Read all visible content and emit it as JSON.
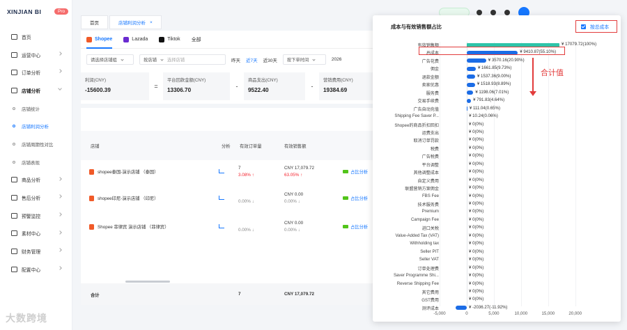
{
  "app": {
    "brand": "XINJIAN BI",
    "badge": "Pro"
  },
  "sidebar": {
    "items": [
      {
        "label": "首页",
        "icon": "home-icon"
      },
      {
        "label": "运营中心",
        "icon": "monitor-icon"
      },
      {
        "label": "订单分析",
        "icon": "chart-icon"
      },
      {
        "label": "店铺分析",
        "icon": "shop-icon",
        "open": true
      },
      {
        "label": "商品分析",
        "icon": "goods-icon"
      },
      {
        "label": "售后分析",
        "icon": "aftersale-icon"
      },
      {
        "label": "预警监控",
        "icon": "alert-icon"
      },
      {
        "label": "素材中心",
        "icon": "media-icon"
      },
      {
        "label": "财务管理",
        "icon": "finance-icon"
      },
      {
        "label": "配置中心",
        "icon": "settings-icon"
      }
    ],
    "sub": [
      {
        "label": "店铺统计"
      },
      {
        "label": "店铺利润分析",
        "active": true
      },
      {
        "label": "店铺周期性对比"
      },
      {
        "label": "店铺表现"
      }
    ]
  },
  "tabs": [
    {
      "label": "首页"
    },
    {
      "label": "店铺利润分析",
      "active": true,
      "close": "×"
    }
  ],
  "platforms": [
    "Shopee",
    "Lazada",
    "Tiktok",
    "全部"
  ],
  "filters": {
    "group_placeholder": "请选择店铺组",
    "shop_select": "按店铺",
    "shop_placeholder": "选择店铺",
    "quick_dates": [
      "昨天",
      "近7天",
      "近30天"
    ],
    "time_select": "按下单时间",
    "date_partial": "2026"
  },
  "kpis": [
    {
      "label": "利润(CNY)",
      "value": "-15600.39"
    },
    {
      "label": "平台回款金额(CNY)",
      "value": "13306.70"
    },
    {
      "label": "商品支出(CNY)",
      "value": "9522.40"
    },
    {
      "label": "营销费用(CNY)",
      "value": "19384.69"
    }
  ],
  "operators": [
    "=",
    "-",
    "-"
  ],
  "table": {
    "headers": {
      "shop": "店铺",
      "analysis": "分析",
      "orders": "有效订单量",
      "sales": "有效销售额"
    },
    "rows": [
      {
        "name": "shopee泰国-演示店铺 （泰国）",
        "orders": "7",
        "orders_change": "3.08% ↑",
        "sales": "CNY 17,079.72",
        "sales_change": "63.05% ↑",
        "link": "占比分析"
      },
      {
        "name": "shopee印尼-演示店铺 （印尼）",
        "orders": "",
        "orders_change": "0.00% ↓",
        "sales": "CNY 0.00",
        "sales_change": "0.00% ↓",
        "link": "占比分析"
      },
      {
        "name": "Shopee 菲律宾 演示店铺 （菲律宾）",
        "orders": "",
        "orders_change": "0.00% ↓",
        "sales": "CNY 0.00",
        "sales_change": "0.00% ↓",
        "link": "占比分析"
      }
    ],
    "footer": {
      "label": "合计",
      "orders": "7",
      "sales": "CNY 17,079.72"
    }
  },
  "popup": {
    "title": "成本与有效销售额占比",
    "checkbox_label": "按总成本",
    "annotation": "合计值"
  },
  "chart_data": {
    "type": "bar",
    "orientation": "horizontal",
    "categories": [
      "有效销售额",
      "总成本",
      "广告花费",
      "佣金",
      "退款金额",
      "卖家优惠",
      "服务费",
      "交易手续费",
      "广告自动充值",
      "Shipping Fee Saver P...",
      "Shopee的商品折扣回扣",
      "运费支出",
      "取消订单罚款",
      "税费",
      "广告税费",
      "平台调整",
      "其他调整成本",
      "自定义费用",
      "联盟营销方案佣金",
      "FBS Fee",
      "技术服务费",
      "Premium",
      "Campaign Fee",
      "进口关税",
      "Value-Added Tax (VAT)",
      "Withholding tax",
      "Seller PIT",
      "Seller VAT",
      "订单处理费",
      "Saver Programme Shi...",
      "Reverse Shipping Fee",
      "其它费用",
      "GST费用",
      "测评成本"
    ],
    "values": [
      17079.72,
      9410.87,
      3570.16,
      1661.85,
      1537.36,
      1518.93,
      1198.06,
      791.83,
      111.04,
      10.24,
      0,
      0,
      0,
      0,
      0,
      0,
      0,
      0,
      0,
      0,
      0,
      0,
      0,
      0,
      0,
      0,
      0,
      0,
      0,
      0,
      0,
      0,
      0,
      -2036.27
    ],
    "labels": [
      "¥ 17079.72(100%)",
      "¥ 9410.87(55.10%)",
      "¥ 3570.16(20.90%)",
      "¥ 1661.85(9.73%)",
      "¥ 1537.36(9.00%)",
      "¥ 1518.93(8.89%)",
      "¥ 1198.06(7.01%)",
      "¥ 791.83(4.64%)",
      "¥ 111.04(0.65%)",
      "¥ 10.24(0.06%)",
      "¥ 0(0%)",
      "¥ 0(0%)",
      "¥ 0(0%)",
      "¥ 0(0%)",
      "¥ 0(0%)",
      "¥ 0(0%)",
      "¥ 0(0%)",
      "¥ 0(0%)",
      "¥ 0(0%)",
      "¥ 0(0%)",
      "¥ 0(0%)",
      "¥ 0(0%)",
      "¥ 0(0%)",
      "¥ 0(0%)",
      "¥ 0(0%)",
      "¥ 0(0%)",
      "¥ 0(0%)",
      "¥ 0(0%)",
      "¥ 0(0%)",
      "¥ 0(0%)",
      "¥ 0(0%)",
      "¥ 0(0%)",
      "¥ 0(0%)",
      "¥ -2036.27(-11.92%)"
    ],
    "xlim": [
      -5000,
      20000
    ],
    "xticks": [
      "-5,000",
      "0",
      "5,000",
      "10,000",
      "15,000",
      "20,000"
    ],
    "colors": {
      "first": "#2ec4a9",
      "rest": "#1b6ce6"
    }
  },
  "watermark": "大数跨境"
}
